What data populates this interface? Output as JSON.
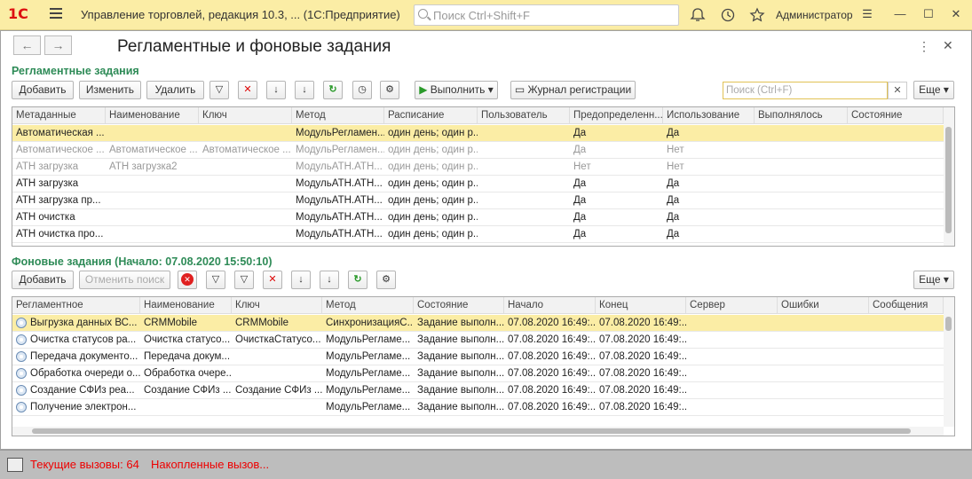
{
  "app": {
    "title": "Управление торговлей, редакция 10.3, ...   (1С:Предприятие)",
    "search_placeholder": "Поиск Ctrl+Shift+F",
    "user": "Администратор"
  },
  "form": {
    "title": "Регламентные и фоновые задания",
    "scheduled": {
      "group_title": "Регламентные задания",
      "buttons": {
        "add": "Добавить",
        "edit": "Изменить",
        "delete": "Удалить",
        "run": "Выполнить",
        "log": "Журнал регистрации",
        "more": "Еще"
      },
      "search_placeholder": "Поиск (Ctrl+F)",
      "columns": [
        "Метаданные",
        "Наименование",
        "Ключ",
        "Метод",
        "Расписание",
        "Пользователь",
        "Предопределенн...",
        "Использование",
        "Выполнялось",
        "Состояние"
      ],
      "rows": [
        {
          "meta": "Автоматическая ...",
          "name": "",
          "key": "",
          "method": "МодульРегламен...",
          "schedule": "один день; один р...",
          "user": "",
          "predefined": "Да",
          "usage": "Да",
          "ran": "",
          "state": "",
          "style": "sel"
        },
        {
          "meta": "Автоматическое ...",
          "name": "Автоматическое ...",
          "key": "Автоматическое ...",
          "method": "МодульРегламен...",
          "schedule": "один день; один р...",
          "user": "",
          "predefined": "Да",
          "usage": "Нет",
          "ran": "",
          "state": "",
          "style": "gray"
        },
        {
          "meta": "ATH загрузка",
          "name": "ATH загрузка2",
          "key": "",
          "method": "МодульATH.ATH...",
          "schedule": "один день; один р...",
          "user": "",
          "predefined": "Нет",
          "usage": "Нет",
          "ran": "",
          "state": "",
          "style": "gray"
        },
        {
          "meta": "ATH загрузка",
          "name": "",
          "key": "",
          "method": "МодульATH.ATH...",
          "schedule": "один день; один р...",
          "user": "",
          "predefined": "Да",
          "usage": "Да",
          "ran": "",
          "state": "",
          "style": ""
        },
        {
          "meta": "ATH загрузка пр...",
          "name": "",
          "key": "",
          "method": "МодульATH.ATH...",
          "schedule": "один день; один р...",
          "user": "",
          "predefined": "Да",
          "usage": "Да",
          "ran": "",
          "state": "",
          "style": ""
        },
        {
          "meta": "ATH очистка",
          "name": "",
          "key": "",
          "method": "МодульATH.ATH...",
          "schedule": "один день; один р...",
          "user": "",
          "predefined": "Да",
          "usage": "Да",
          "ran": "",
          "state": "",
          "style": ""
        },
        {
          "meta": "ATH очистка про...",
          "name": "",
          "key": "",
          "method": "МодульATH.ATH...",
          "schedule": "один день; один р...",
          "user": "",
          "predefined": "Да",
          "usage": "Да",
          "ran": "",
          "state": "",
          "style": ""
        }
      ]
    },
    "background": {
      "group_title": "Фоновые задания (Начало: 07.08.2020 15:50:10)",
      "buttons": {
        "add": "Добавить",
        "cancel_search": "Отменить поиск",
        "more": "Еще"
      },
      "columns": [
        "Регламентное",
        "Наименование",
        "Ключ",
        "Метод",
        "Состояние",
        "Начало",
        "Конец",
        "Сервер",
        "Ошибки",
        "Сообщения"
      ],
      "rows": [
        {
          "sched": "Выгрузка данных ВС...",
          "name": "CRMMobile",
          "key": "CRMMobile",
          "method": "СинхронизацияС...",
          "state": "Задание выполн...",
          "start": "07.08.2020 16:49:...",
          "end": "07.08.2020 16:49:...",
          "style": "sel"
        },
        {
          "sched": "Очистка статусов ра...",
          "name": "Очистка статусо...",
          "key": "ОчисткаСтатусо...",
          "method": "МодульРегламе...",
          "state": "Задание выполн...",
          "start": "07.08.2020 16:49:...",
          "end": "07.08.2020 16:49:...",
          "style": ""
        },
        {
          "sched": "Передача документо...",
          "name": "Передача докум...",
          "key": "",
          "method": "МодульРегламе...",
          "state": "Задание выполн...",
          "start": "07.08.2020 16:49:...",
          "end": "07.08.2020 16:49:...",
          "style": ""
        },
        {
          "sched": "Обработка очереди о...",
          "name": "Обработка очере...",
          "key": "",
          "method": "МодульРегламе...",
          "state": "Задание выполн...",
          "start": "07.08.2020 16:49:...",
          "end": "07.08.2020 16:49:...",
          "style": ""
        },
        {
          "sched": "Создание СФИз реа...",
          "name": "Создание СФИз ...",
          "key": "Создание СФИз ...",
          "method": "МодульРегламе...",
          "state": "Задание выполн...",
          "start": "07.08.2020 16:49:...",
          "end": "07.08.2020 16:49:...",
          "style": ""
        },
        {
          "sched": "Получение электрон...",
          "name": "",
          "key": "",
          "method": "МодульРегламе...",
          "state": "Задание выполн...",
          "start": "07.08.2020 16:49:...",
          "end": "07.08.2020 16:49:...",
          "style": ""
        }
      ]
    }
  },
  "status": {
    "current_calls": "Текущие вызовы: 64",
    "accumulated_calls": "Накопленные вызов..."
  }
}
